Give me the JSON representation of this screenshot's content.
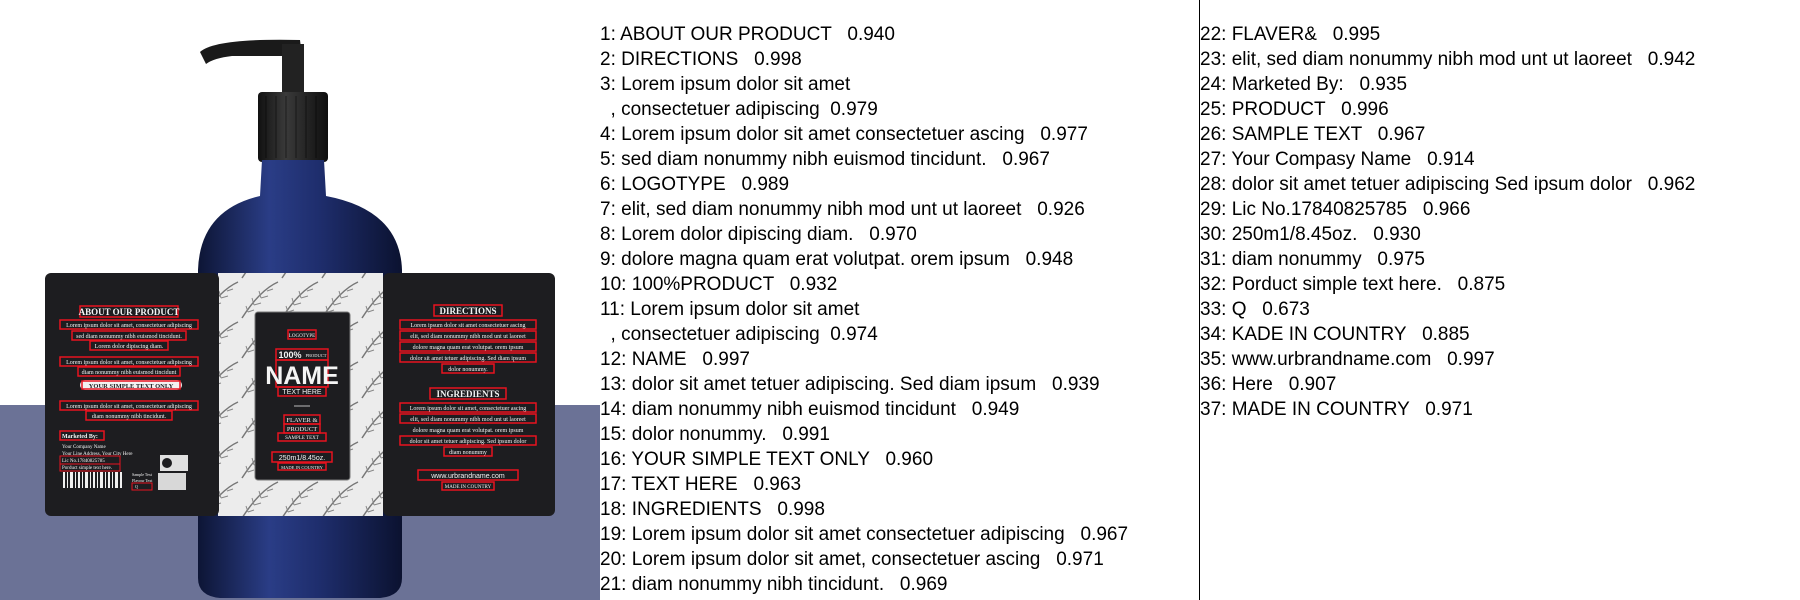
{
  "image": {
    "label_left": {
      "about_title": "ABOUT OUR PRODUCT",
      "about_line1": "Lorem ipsum dolor sit amet, consectetuer adipiscing",
      "about_line2": "sed diam nonummy nibh euismod tincidunt.",
      "about_line3": "Lorem dolor dipiscing diam.",
      "block2_line1": "Lorem ipsum dolor sit amet, consectetuer adipiscing",
      "block2_line2": "diam nonummy nibh euismod tincidunt",
      "simple_text": "YOUR SIMPLE TEXT ONLY",
      "block3_line1": "Lorem ipsum dolor sit amet, consectetuer adipiscing",
      "block3_line2": "diam nonummy nibh tincidunt.",
      "marketed_by": "Marketed By:",
      "company": "Your Company Name",
      "address": "Your Line Address, Your City Here",
      "lic": "Lic No.17840825785",
      "simple_here": "Porduct simple text here.",
      "sample_text": "Sample Text",
      "flavor_small": "Flavour Text",
      "q": "Q"
    },
    "label_center": {
      "logotype": "LOGOTYPE",
      "percent": "100%",
      "product_small": "PRODUCT",
      "name": "NAME",
      "text_here": "TEXT HERE",
      "flaver": "FLAVER &",
      "product": "PRODUCT",
      "sample_text": "SAMPLE TEXT",
      "volume": "250m1/8.45oz.",
      "made_in": "MADE IN COUNTRY"
    },
    "label_right": {
      "directions_title": "DIRECTIONS",
      "dir_line1": "Lorem ipsum dolor sit amet consectetuer ascing",
      "dir_line2": "elit, sed diam nonummy nibh mod unt ut laoreet",
      "dir_line3": "dolore magna quam erat volutpat. orem ipsum",
      "dir_line4": "dolor sit amet tetuer adipiscing. Sed diam ipsum",
      "dir_line5": "dolor nonummy.",
      "ingredients_title": "INGREDIENTS",
      "ing_line1": "Lorem ipsum dolor sit amet, consectetuer ascing",
      "ing_line2": "elit, sed diam nonummy nibh mod unt ut laoreet",
      "ing_line3": "dolore magna quam erat volutpat. orem ipsum",
      "ing_line4": "dolor sit amet tetuer adipiscing. Sed ipsum dolor",
      "ing_line5": "diam nonummy",
      "website": "www.urbrandname.com",
      "made_in": "MADE IN COUNTRY"
    },
    "colors": {
      "bottle": "#1f2f6e",
      "label_dark": "#1d1d20",
      "floor": "#6b7296",
      "box": "#e8131f"
    }
  },
  "detections": {
    "column1": [
      "1: ABOUT OUR PRODUCT   0.940",
      "2: DIRECTIONS   0.998",
      "3: Lorem ipsum dolor sit amet",
      "  , consectetuer adipiscing  0.979",
      "4: Lorem ipsum dolor sit amet consectetuer ascing   0.977",
      "5: sed diam nonummy nibh euismod tincidunt.   0.967",
      "6: LOGOTYPE   0.989",
      "7: elit, sed diam nonummy nibh mod unt ut laoreet   0.926",
      "8: Lorem dolor dipiscing diam.   0.970",
      "9: dolore magna quam erat volutpat. orem ipsum   0.948",
      "10: 100%PRODUCT   0.932",
      "11: Lorem ipsum dolor sit amet",
      "  , consectetuer adipiscing  0.974",
      "12: NAME   0.997",
      "13: dolor sit amet tetuer adipiscing. Sed diam ipsum   0.939",
      "14: diam nonummy nibh euismod tincidunt   0.949",
      "15: dolor nonummy.   0.991",
      "16: YOUR SIMPLE TEXT ONLY   0.960",
      "17: TEXT HERE   0.963",
      "18: INGREDIENTS   0.998",
      "19: Lorem ipsum dolor sit amet consectetuer adipiscing   0.967",
      "20: Lorem ipsum dolor sit amet, consectetuer ascing   0.971",
      "21: diam nonummy nibh tincidunt.   0.969"
    ],
    "column2": [
      "22: FLAVER&   0.995",
      "23: elit, sed diam nonummy nibh mod unt ut laoreet   0.942",
      "24: Marketed By:   0.935",
      "25: PRODUCT   0.996",
      "26: SAMPLE TEXT   0.967",
      "27: Your Compasy Name   0.914",
      "28: dolor sit amet tetuer adipiscing Sed ipsum dolor   0.962",
      "29: Lic No.17840825785   0.966",
      "30: 250m1/8.45oz.   0.930",
      "31: diam nonummy   0.975",
      "32: Porduct simple text here.   0.875",
      "33: Q   0.673",
      "34: KADE IN COUNTRY   0.885",
      "35: www.urbrandname.com   0.997",
      "36: Here   0.907",
      "37: MADE IN COUNTRY   0.971"
    ]
  }
}
